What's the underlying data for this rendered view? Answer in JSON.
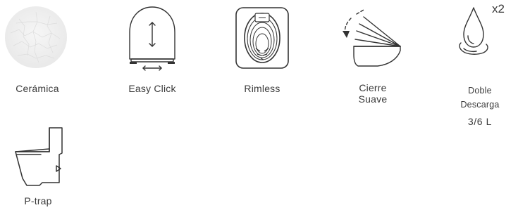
{
  "features": [
    {
      "icon": "ceramic-texture-icon",
      "label": "Cerámica"
    },
    {
      "icon": "toilet-seat-icon",
      "label": "Easy Click"
    },
    {
      "icon": "rimless-bowl-icon",
      "label": "Rimless"
    },
    {
      "icon": "soft-close-lid-icon",
      "label_line1": "Cierre",
      "label_line2": "Suave"
    },
    {
      "icon": "water-drop-icon",
      "multiplier": "x2",
      "label_line1": "Doble",
      "label_line2": "Descarga",
      "label_line3": "3/6 L"
    },
    {
      "icon": "p-trap-toilet-icon",
      "label": "P-trap"
    }
  ],
  "colors": {
    "stroke": "#333333",
    "text": "#3a3a3a",
    "ceramic": "#efefef"
  }
}
